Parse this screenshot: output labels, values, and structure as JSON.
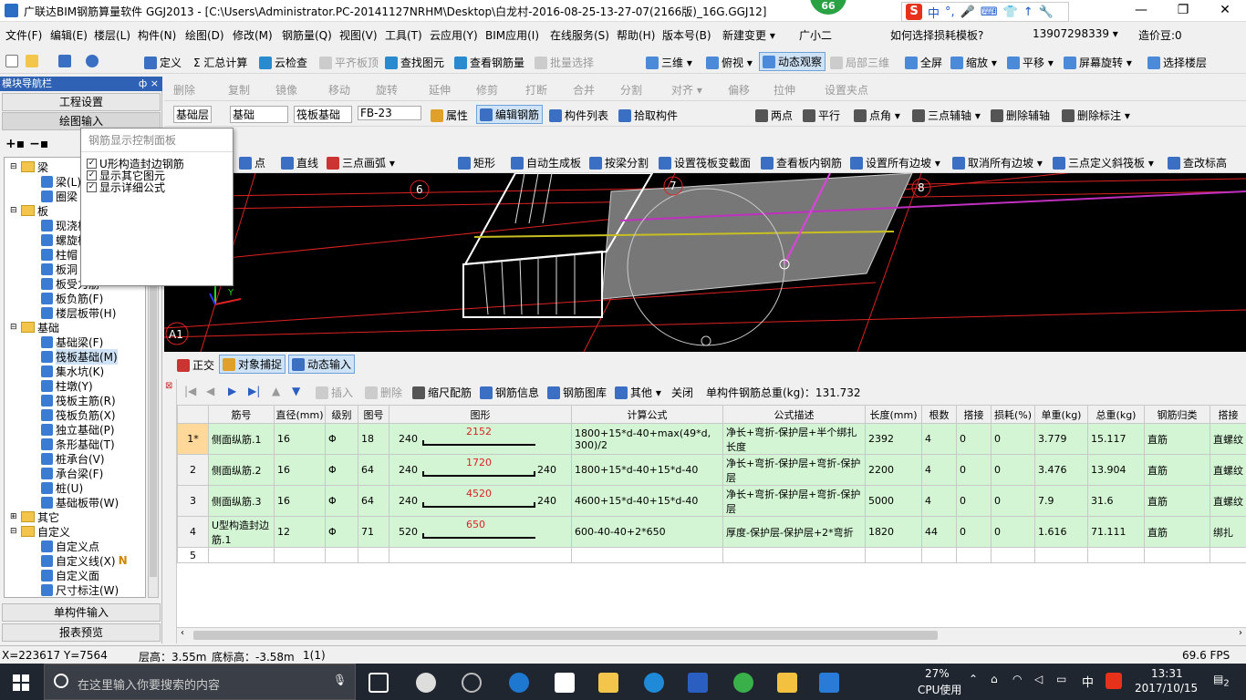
{
  "window": {
    "title": "广联达BIM钢筋算量软件 GGJ2013 - [C:\\Users\\Administrator.PC-20141127NRHM\\Desktop\\白龙村-2016-08-25-13-27-07(2166版)_16G.GGJ12]",
    "badge": "66",
    "minimize": "—",
    "maximize": "❐",
    "close": "✕"
  },
  "ime": {
    "logo": "S",
    "items": [
      "中",
      "°,",
      "🎤",
      "⌨",
      "👕",
      "↑",
      "🔧"
    ]
  },
  "menu": [
    "文件(F)",
    "编辑(E)",
    "楼层(L)",
    "构件(N)",
    "绘图(D)",
    "修改(M)",
    "钢筋量(Q)",
    "视图(V)",
    "工具(T)",
    "云应用(Y)",
    "BIM应用(I)",
    "在线服务(S)",
    "帮助(H)",
    "版本号(B)",
    "新建变更 ▾",
    "广小二"
  ],
  "menu_right": {
    "help_link": "如何选择损耗模板?",
    "phone": "13907298339 ▾",
    "price": "造价豆:0"
  },
  "toolbar1": [
    "定义",
    "Σ 汇总计算",
    "云检查",
    "平齐板顶",
    "查找图元",
    "查看钢筋量",
    "批量选择",
    "三维 ▾",
    "俯视 ▾",
    "动态观察",
    "局部三维",
    "全屏",
    "缩放 ▾",
    "平移 ▾",
    "屏幕旋转 ▾",
    "选择楼层"
  ],
  "toolbar2": [
    "删除",
    "复制",
    "镜像",
    "移动",
    "旋转",
    "延伸",
    "修剪",
    "打断",
    "合并",
    "分割",
    "对齐 ▾",
    "偏移",
    "拉伸",
    "设置夹点"
  ],
  "toolbar3": {
    "layer": "基础层",
    "floor": "基础",
    "type": "筏板基础",
    "code": "FB-23",
    "buttons": [
      "属性",
      "编辑钢筋",
      "构件列表",
      "拾取构件"
    ],
    "axis": [
      "两点",
      "平行",
      "点角 ▾",
      "三点辅轴 ▾",
      "删除辅轴",
      "删除标注 ▾"
    ]
  },
  "toolbar4": [
    "点",
    "直线",
    "三点画弧 ▾",
    "矩形",
    "自动生成板",
    "按梁分割",
    "设置筏板变截面",
    "查看板内钢筋",
    "设置所有边坡 ▾",
    "取消所有边坡 ▾",
    "三点定义斜筏板 ▾",
    "查改标高"
  ],
  "nav": {
    "header": "模块导航栏",
    "pin": "ф ×",
    "btn_project": "工程设置",
    "btn_draw": "绘图输入",
    "btn_single": "单构件输入",
    "btn_report": "报表预览"
  },
  "tree": [
    {
      "label": "梁",
      "level": 0,
      "folder": true,
      "exp": "⊟"
    },
    {
      "label": "梁(L)",
      "level": 1,
      "icon": "beam-icon"
    },
    {
      "label": "圈梁",
      "level": 1,
      "icon": "ring-beam-icon"
    },
    {
      "label": "板",
      "level": 0,
      "folder": true,
      "exp": "⊟"
    },
    {
      "label": "现浇板",
      "level": 1,
      "icon": "slab-icon"
    },
    {
      "label": "螺旋板",
      "level": 1,
      "icon": "spiral-slab-icon"
    },
    {
      "label": "柱帽",
      "level": 1,
      "icon": "column-cap-icon"
    },
    {
      "label": "板洞",
      "level": 1,
      "icon": "slab-hole-icon"
    },
    {
      "label": "板受力筋",
      "level": 1,
      "icon": "slab-rebar-icon"
    },
    {
      "label": "板负筋(F)",
      "level": 1,
      "icon": "neg-rebar-icon"
    },
    {
      "label": "楼层板带(H)",
      "level": 1,
      "icon": "slab-band-icon"
    },
    {
      "label": "基础",
      "level": 0,
      "folder": true,
      "exp": "⊟"
    },
    {
      "label": "基础梁(F)",
      "level": 1,
      "icon": "foundation-beam-icon"
    },
    {
      "label": "筏板基础(M)",
      "level": 1,
      "icon": "raft-foundation-icon",
      "selected": true
    },
    {
      "label": "集水坑(K)",
      "level": 1,
      "icon": "sump-icon"
    },
    {
      "label": "柱墩(Y)",
      "level": 1,
      "icon": "column-pier-icon"
    },
    {
      "label": "筏板主筋(R)",
      "level": 1,
      "icon": "raft-main-rebar-icon"
    },
    {
      "label": "筏板负筋(X)",
      "level": 1,
      "icon": "raft-neg-rebar-icon"
    },
    {
      "label": "独立基础(P)",
      "level": 1,
      "icon": "isolated-footing-icon"
    },
    {
      "label": "条形基础(T)",
      "level": 1,
      "icon": "strip-footing-icon"
    },
    {
      "label": "桩承台(V)",
      "level": 1,
      "icon": "pile-cap-icon"
    },
    {
      "label": "承台梁(F)",
      "level": 1,
      "icon": "cap-beam-icon"
    },
    {
      "label": "桩(U)",
      "level": 1,
      "icon": "pile-icon"
    },
    {
      "label": "基础板带(W)",
      "level": 1,
      "icon": "foundation-band-icon"
    },
    {
      "label": "其它",
      "level": 0,
      "folder": true,
      "exp": "⊞"
    },
    {
      "label": "自定义",
      "level": 0,
      "folder": true,
      "exp": "⊟"
    },
    {
      "label": "自定义点",
      "level": 1,
      "icon": "custom-point-icon"
    },
    {
      "label": "自定义线(X)",
      "level": 1,
      "icon": "custom-line-icon",
      "new": "N"
    },
    {
      "label": "自定义面",
      "level": 1,
      "icon": "custom-face-icon"
    },
    {
      "label": "尺寸标注(W)",
      "level": 1,
      "icon": "dimension-icon"
    }
  ],
  "popup": {
    "title": "钢筋显示控制面板",
    "items": [
      "U形构造封边钢筋",
      "显示其它图元",
      "显示详细公式"
    ],
    "check": "✓"
  },
  "view3d": {
    "axis_labels": [
      "6",
      "7",
      "8",
      "A1"
    ],
    "axis_y": "Y"
  },
  "viewbar": [
    "正交",
    "对象捕捉",
    "动态输入"
  ],
  "rebarbar": {
    "nav": [
      "|◀",
      "◀",
      "▶",
      "▶|",
      "▲",
      "▼"
    ],
    "buttons": [
      "插入",
      "删除",
      "缩尺配筋",
      "钢筋信息",
      "钢筋图库",
      "其他 ▾",
      "关闭"
    ],
    "total_label": "单构件钢筋总重(kg)：131.732"
  },
  "table": {
    "headers": [
      "",
      "筋号",
      "直径(mm)",
      "级别",
      "图号",
      "图形",
      "计算公式",
      "公式描述",
      "长度(mm)",
      "根数",
      "搭接",
      "损耗(%)",
      "单重(kg)",
      "总重(kg)",
      "钢筋归类",
      "搭接"
    ],
    "rows": [
      {
        "no": "1*",
        "name": "侧面纵筋.1",
        "dia": "16",
        "grade": "Φ",
        "fig": "18",
        "shape_l": "240",
        "shape_m": "2152",
        "shape_r": "",
        "formula": "1800+15*d-40+max(49*d, 300)/2",
        "desc": "净长+弯折-保护层+半个绑扎长度",
        "len": "2392",
        "count": "4",
        "lap": "0",
        "loss": "0",
        "unit": "3.779",
        "total": "15.117",
        "cls": "直筋",
        "laptype": "直螺纹"
      },
      {
        "no": "2",
        "name": "侧面纵筋.2",
        "dia": "16",
        "grade": "Φ",
        "fig": "64",
        "shape_l": "240",
        "shape_m": "1720",
        "shape_r": "240",
        "formula": "1800+15*d-40+15*d-40",
        "desc": "净长+弯折-保护层+弯折-保护层",
        "len": "2200",
        "count": "4",
        "lap": "0",
        "loss": "0",
        "unit": "3.476",
        "total": "13.904",
        "cls": "直筋",
        "laptype": "直螺纹"
      },
      {
        "no": "3",
        "name": "侧面纵筋.3",
        "dia": "16",
        "grade": "Φ",
        "fig": "64",
        "shape_l": "240",
        "shape_m": "4520",
        "shape_r": "240",
        "formula": "4600+15*d-40+15*d-40",
        "desc": "净长+弯折-保护层+弯折-保护层",
        "len": "5000",
        "count": "4",
        "lap": "0",
        "loss": "0",
        "unit": "7.9",
        "total": "31.6",
        "cls": "直筋",
        "laptype": "直螺纹"
      },
      {
        "no": "4",
        "name": "U型构造封边筋.1",
        "dia": "12",
        "grade": "Φ",
        "fig": "71",
        "shape_l": "520",
        "shape_m": "650",
        "shape_r": "",
        "formula": "600-40-40+2*650",
        "desc": "厚度-保护层-保护层+2*弯折",
        "len": "1820",
        "count": "44",
        "lap": "0",
        "loss": "0",
        "unit": "1.616",
        "total": "71.111",
        "cls": "直筋",
        "laptype": "绑扎"
      }
    ],
    "empty_row": "5"
  },
  "status": {
    "coords": "X=223617 Y=7564",
    "floor_h": "层高：3.55m",
    "bottom_h": "底标高：-3.58m",
    "sel": "1(1)",
    "fps": "69.6 FPS"
  },
  "taskbar": {
    "search": "在这里输入你要搜索的内容",
    "cpu": "27%",
    "cpu_label": "CPU使用",
    "ime": "中",
    "time": "13:31",
    "date": "2017/10/15",
    "notify": "2"
  },
  "colors": {
    "accent": "#2f62b4",
    "grid_green": "#d4f5d4",
    "view_bg": "#000000",
    "taskbar": "#1f2630"
  }
}
